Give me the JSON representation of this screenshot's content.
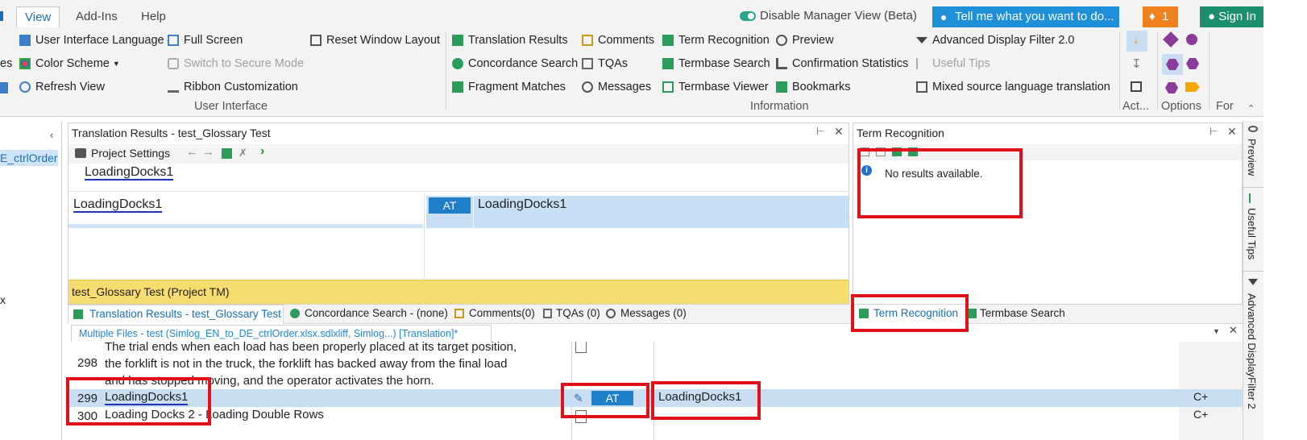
{
  "tabs": {
    "view": "View",
    "addins": "Add-Ins",
    "help": "Help"
  },
  "toggle_label": "Disable Manager View (Beta)",
  "tell_me": "Tell me what you want to do...",
  "notif_count": "1",
  "sign_in": "Sign In",
  "ribbon": {
    "ui_language": "User Interface Language",
    "full_screen": "Full Screen",
    "reset_layout": "Reset Window Layout",
    "color_scheme": "Color Scheme",
    "secure_mode": "Switch to Secure Mode",
    "refresh_view": "Refresh View",
    "ribbon_custom": "Ribbon Customization",
    "group_ui": "User Interface",
    "translation_results": "Translation Results",
    "comments": "Comments",
    "term_recognition": "Term Recognition",
    "preview": "Preview",
    "adv_filter": "Advanced Display Filter 2.0",
    "concordance": "Concordance Search",
    "tqas": "TQAs",
    "termbase_search": "Termbase Search",
    "confirmation_stats": "Confirmation Statistics",
    "useful_tips": "Useful Tips",
    "fragment_matches": "Fragment Matches",
    "messages": "Messages",
    "termbase_viewer": "Termbase Viewer",
    "bookmarks": "Bookmarks",
    "mixed_source": "Mixed source language translation",
    "group_info": "Information",
    "group_act": "Act...",
    "group_options": "Options",
    "group_for": "For"
  },
  "left": {
    "item": "E_ctrlOrder.",
    "x": "x"
  },
  "tr_panel": {
    "title": "Translation Results - test_Glossary Test",
    "project_settings": "Project Settings",
    "source": "LoadingDocks1",
    "left_text": "LoadingDocks1",
    "badge": "AT",
    "right_text": "LoadingDocks1",
    "tm_bar": "test_Glossary Test (Project TM)"
  },
  "term_panel": {
    "title": "Term Recognition",
    "no_results": "No results available."
  },
  "bottom_tabs": {
    "tr": "Translation Results - test_Glossary Test",
    "concordance": "Concordance Search - (none)",
    "comments": "Comments(0)",
    "tqas": "TQAs (0)",
    "messages": "Messages (0)",
    "term": "Term Recognition",
    "termbase": "Termbase Search"
  },
  "doc_tab": "Multiple Files - test (Simlog_EN_to_DE_ctrlOrder.xlsx.sdlxliff, Simlog...) [Translation]*",
  "rows": [
    {
      "num": "298",
      "lines": [
        "The trial ends when each load has been properly placed at its target position,",
        "the forklift is not in the truck, the forklift has backed away from the final load",
        "and has stopped moving, and the operator activates the horn."
      ]
    },
    {
      "num": "299",
      "source": "LoadingDocks1",
      "badge": "AT",
      "target": "LoadingDocks1",
      "status": "C+"
    },
    {
      "num": "300",
      "source": "Loading Docks 2 - Loading Double Rows",
      "status": "C+"
    }
  ],
  "side": {
    "preview": "Preview",
    "tips": "Useful Tips",
    "filter": "Advanced DisplayFilter 2"
  }
}
